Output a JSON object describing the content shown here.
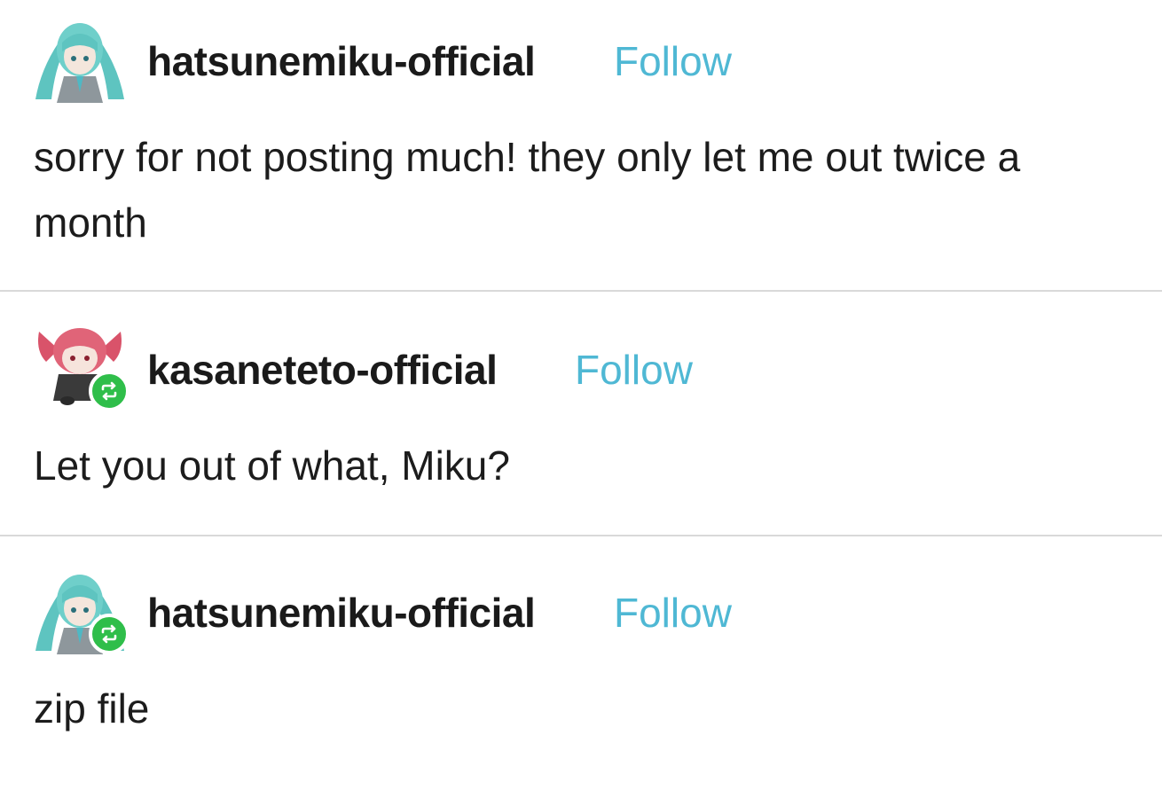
{
  "posts": [
    {
      "username": "hatsunemiku-official",
      "follow_label": "Follow",
      "avatar_icon": "hatsune-miku-avatar-icon",
      "reblogged": false,
      "text": "sorry for not posting much! they only let me out twice a month"
    },
    {
      "username": "kasaneteto-official",
      "follow_label": "Follow",
      "avatar_icon": "kasane-teto-avatar-icon",
      "reblogged": true,
      "text": "Let you out of what, Miku?"
    },
    {
      "username": "hatsunemiku-official",
      "follow_label": "Follow",
      "avatar_icon": "hatsune-miku-avatar-icon",
      "reblogged": true,
      "text": "zip file"
    }
  ],
  "colors": {
    "follow": "#4fb8d4",
    "reblog_badge": "#2fbe4a",
    "divider": "#d9d9d9",
    "text": "#1c1c1c"
  }
}
